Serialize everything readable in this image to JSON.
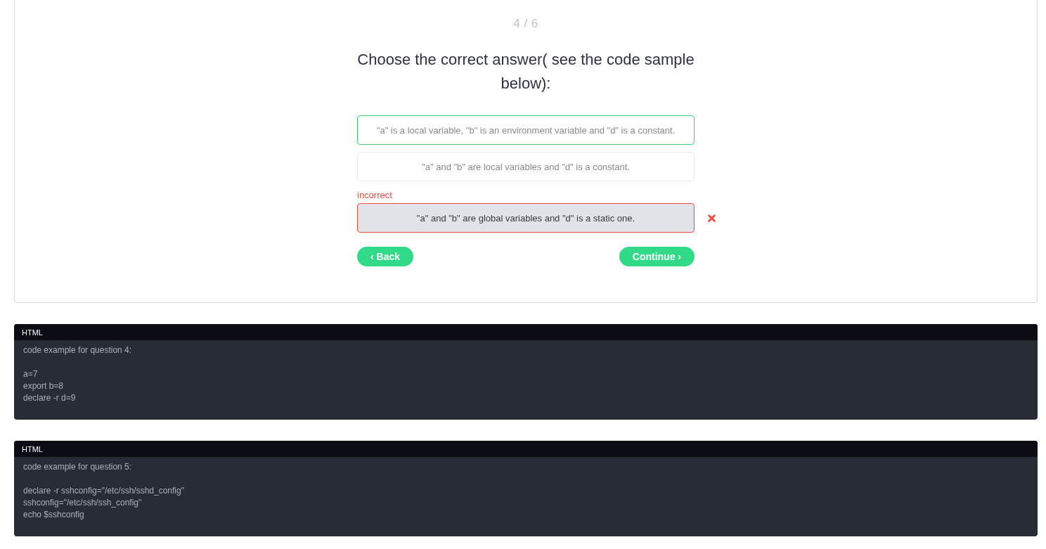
{
  "quiz": {
    "progress": "4 / 6",
    "question": "Choose the correct answer( see the code sample below):",
    "answers": [
      {
        "text": "\"a\" is a local variable, \"b\" is an environment variable and \"d\" is a constant.",
        "selected": false,
        "correct": true
      },
      {
        "text": "\"a\" and \"b\" are local variables and \"d\" is a constant.",
        "selected": false,
        "correct": false
      },
      {
        "text": "\"a\" and \"b\" are global variables and \"d\" is a static one.",
        "selected": true,
        "correct": false,
        "feedback": "incorrect"
      }
    ],
    "buttons": [
      {
        "label": "‹ Back",
        "kind": "back"
      },
      {
        "label": "Continue ›",
        "kind": "continue"
      }
    ]
  },
  "code_samples": [
    {
      "language": "HTML",
      "code": "code example for question 4:\n\na=7\nexport b=8\ndeclare -r d=9"
    },
    {
      "language": "HTML",
      "code": "code example for question 5:\n\ndeclare -r sshconfig=\"/etc/ssh/sshd_config\"\nsshconfig=\"/etc/ssh/ssh_config\"\necho $sshconfig"
    }
  ]
}
